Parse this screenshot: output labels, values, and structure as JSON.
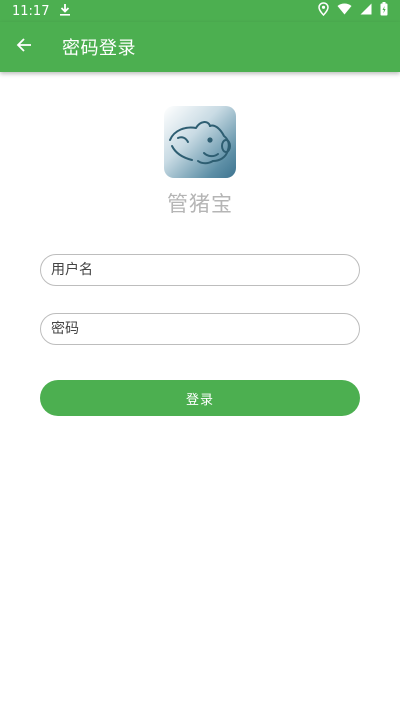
{
  "status_bar": {
    "time": "11:17",
    "icons": [
      "download-icon",
      "location-icon",
      "wifi-icon",
      "signal-icon",
      "battery-icon"
    ]
  },
  "app_bar": {
    "back_icon": "arrow-left-icon",
    "title": "密码登录"
  },
  "brand": {
    "logo_icon": "pig-logo",
    "name": "管猪宝"
  },
  "form": {
    "username_placeholder": "用户名",
    "username_value": "",
    "password_placeholder": "密码",
    "password_value": "",
    "login_label": "登录"
  },
  "colors": {
    "primary": "#4caf50",
    "border": "#bdbdbd",
    "brand_text": "#b5b5b5"
  }
}
